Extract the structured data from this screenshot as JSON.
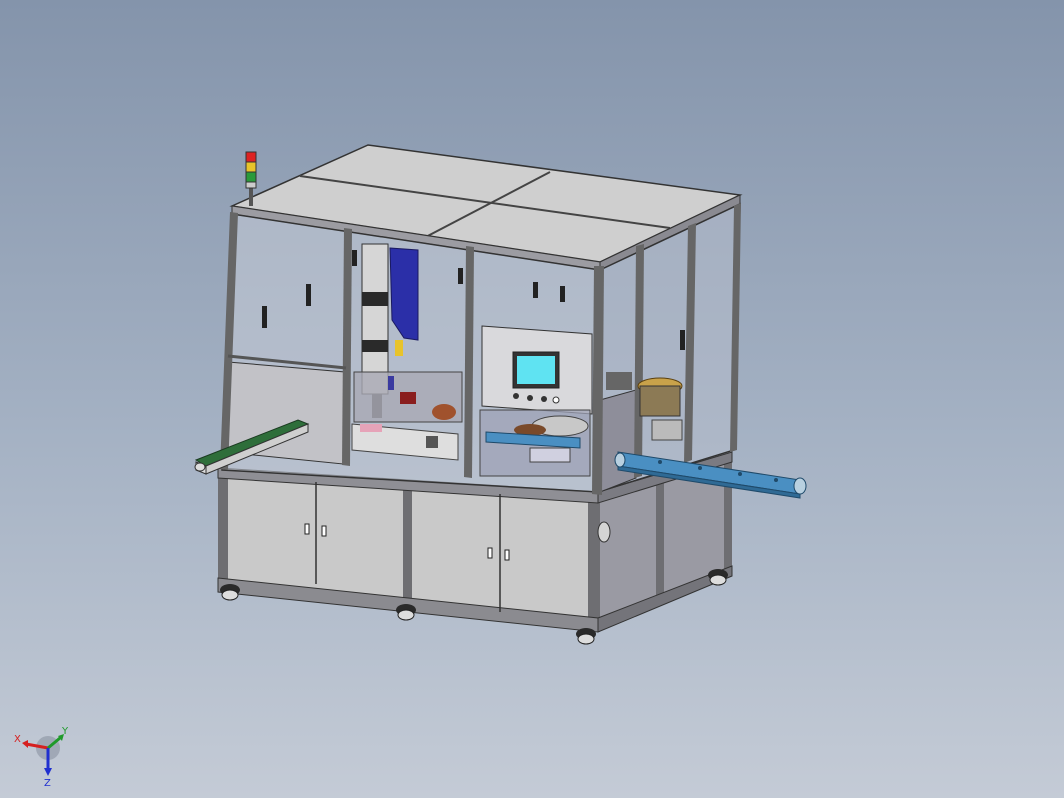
{
  "viewport": {
    "background_top": "#8494ab",
    "background_bottom": "#c4cbd6"
  },
  "model": {
    "description_icon": "automated-assembly-machine",
    "hmi_screen_color": "#5fe3f2",
    "conveyor_color": "#4a8fc2",
    "belt_color": "#2e6e3a",
    "cylinder_color": "#2b2fa8",
    "signal_tower": [
      "red",
      "yellow",
      "green"
    ]
  },
  "triad": {
    "x_label": "X",
    "y_label": "Y",
    "z_label": "Z",
    "x_color": "#d62020",
    "y_color": "#1f9a2a",
    "z_color": "#2030d0"
  }
}
